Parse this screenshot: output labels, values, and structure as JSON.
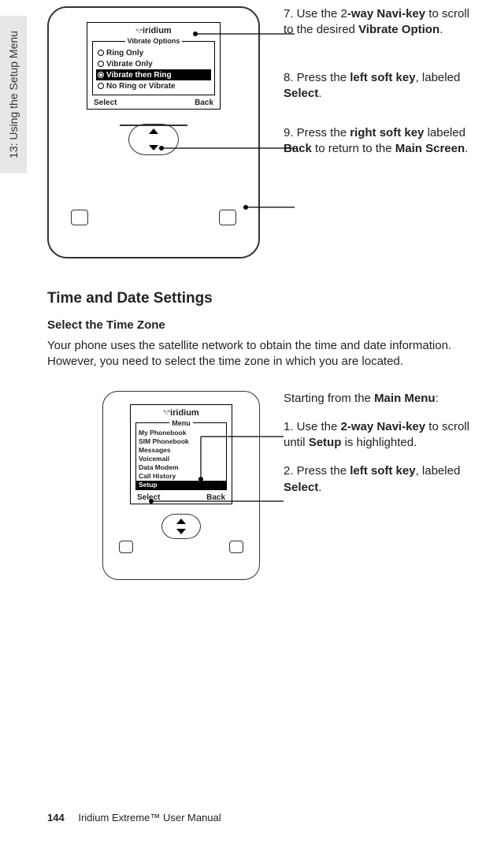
{
  "sideTab": "13: Using the Setup Menu",
  "phone1": {
    "brand": "iridium",
    "legend": "Vibrate Options",
    "options": [
      {
        "label": "Ring Only",
        "selected": false,
        "highlighted": false
      },
      {
        "label": "Vibrate Only",
        "selected": false,
        "highlighted": false
      },
      {
        "label": "Vibrate then Ring",
        "selected": true,
        "highlighted": true
      },
      {
        "label": "No Ring or Vibrate",
        "selected": false,
        "highlighted": false
      }
    ],
    "softLeft": "Select",
    "softRight": "Back"
  },
  "steps1": {
    "s7_pre": "7. Use the 2",
    "s7_b1": "-way Navi-key",
    "s7_mid": " to scroll to the desired ",
    "s7_b2": "Vibrate Option",
    "s7_post": ".",
    "s8_pre": "8. Press the ",
    "s8_b1": "left soft key",
    "s8_mid": ", labeled ",
    "s8_b2": "Select",
    "s8_post": ".",
    "s9_pre": "9. Press the ",
    "s9_b1": "right soft key",
    "s9_mid": " labeled ",
    "s9_b2": "Back",
    "s9_mid2": " to return to the ",
    "s9_b3": "Main Screen",
    "s9_post": "."
  },
  "sectionHeading": "Time and Date Settings",
  "subHeading": "Select the Time Zone",
  "introText": "Your phone uses the satellite network to obtain the time and date information. However, you need to select the time zone in which you are located.",
  "phone2": {
    "brand": "iridium",
    "legend": "Menu",
    "items": [
      {
        "label": "My Phonebook",
        "highlighted": false
      },
      {
        "label": "SIM Phonebook",
        "highlighted": false
      },
      {
        "label": "Messages",
        "highlighted": false
      },
      {
        "label": "Voicemail",
        "highlighted": false
      },
      {
        "label": "Data Modem",
        "highlighted": false
      },
      {
        "label": "Call History",
        "highlighted": false
      },
      {
        "label": "Setup",
        "highlighted": true
      }
    ],
    "softLeft": "Select",
    "softRight": "Back",
    "scrollArrow": "↓"
  },
  "steps2": {
    "lead_pre": "Starting from the ",
    "lead_b": "Main Menu",
    "lead_post": ":",
    "s1_pre": "1. Use the ",
    "s1_b1": "2-way Navi-key",
    "s1_mid": " to scroll until ",
    "s1_b2": "Setup",
    "s1_post": " is highlighted.",
    "s2_pre": "2. Press the ",
    "s2_b1": "left soft key",
    "s2_mid": ", labeled ",
    "s2_b2": "Select",
    "s2_post": "."
  },
  "footer": {
    "page": "144",
    "title": "Iridium Extreme™ User Manual"
  }
}
